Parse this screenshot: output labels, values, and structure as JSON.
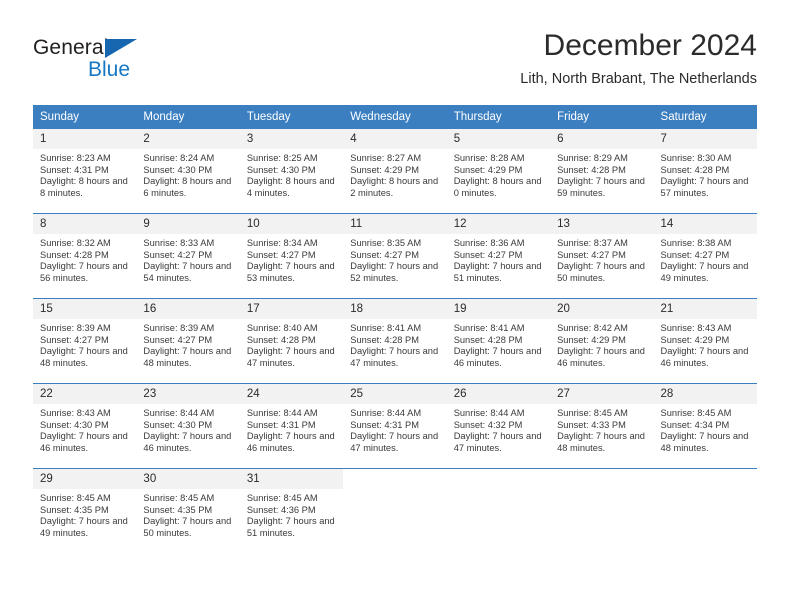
{
  "logo": {
    "word_top": "General",
    "word_bottom": "Blue",
    "accent_color": "#1877c4",
    "text_color": "#231f20"
  },
  "header": {
    "title": "December 2024",
    "subtitle": "Lith, North Brabant, The Netherlands"
  },
  "theme": {
    "header_row_bg": "#3c7fc1",
    "header_row_text": "#ffffff",
    "daynum_bg": "#f2f2f2",
    "body_text": "#3a3a3a"
  },
  "calendar": {
    "weekday_headers": [
      "Sunday",
      "Monday",
      "Tuesday",
      "Wednesday",
      "Thursday",
      "Friday",
      "Saturday"
    ],
    "weeks": [
      [
        {
          "day": "1",
          "sunrise": "Sunrise: 8:23 AM",
          "sunset": "Sunset: 4:31 PM",
          "daylight": "Daylight: 8 hours and 8 minutes."
        },
        {
          "day": "2",
          "sunrise": "Sunrise: 8:24 AM",
          "sunset": "Sunset: 4:30 PM",
          "daylight": "Daylight: 8 hours and 6 minutes."
        },
        {
          "day": "3",
          "sunrise": "Sunrise: 8:25 AM",
          "sunset": "Sunset: 4:30 PM",
          "daylight": "Daylight: 8 hours and 4 minutes."
        },
        {
          "day": "4",
          "sunrise": "Sunrise: 8:27 AM",
          "sunset": "Sunset: 4:29 PM",
          "daylight": "Daylight: 8 hours and 2 minutes."
        },
        {
          "day": "5",
          "sunrise": "Sunrise: 8:28 AM",
          "sunset": "Sunset: 4:29 PM",
          "daylight": "Daylight: 8 hours and 0 minutes."
        },
        {
          "day": "6",
          "sunrise": "Sunrise: 8:29 AM",
          "sunset": "Sunset: 4:28 PM",
          "daylight": "Daylight: 7 hours and 59 minutes."
        },
        {
          "day": "7",
          "sunrise": "Sunrise: 8:30 AM",
          "sunset": "Sunset: 4:28 PM",
          "daylight": "Daylight: 7 hours and 57 minutes."
        }
      ],
      [
        {
          "day": "8",
          "sunrise": "Sunrise: 8:32 AM",
          "sunset": "Sunset: 4:28 PM",
          "daylight": "Daylight: 7 hours and 56 minutes."
        },
        {
          "day": "9",
          "sunrise": "Sunrise: 8:33 AM",
          "sunset": "Sunset: 4:27 PM",
          "daylight": "Daylight: 7 hours and 54 minutes."
        },
        {
          "day": "10",
          "sunrise": "Sunrise: 8:34 AM",
          "sunset": "Sunset: 4:27 PM",
          "daylight": "Daylight: 7 hours and 53 minutes."
        },
        {
          "day": "11",
          "sunrise": "Sunrise: 8:35 AM",
          "sunset": "Sunset: 4:27 PM",
          "daylight": "Daylight: 7 hours and 52 minutes."
        },
        {
          "day": "12",
          "sunrise": "Sunrise: 8:36 AM",
          "sunset": "Sunset: 4:27 PM",
          "daylight": "Daylight: 7 hours and 51 minutes."
        },
        {
          "day": "13",
          "sunrise": "Sunrise: 8:37 AM",
          "sunset": "Sunset: 4:27 PM",
          "daylight": "Daylight: 7 hours and 50 minutes."
        },
        {
          "day": "14",
          "sunrise": "Sunrise: 8:38 AM",
          "sunset": "Sunset: 4:27 PM",
          "daylight": "Daylight: 7 hours and 49 minutes."
        }
      ],
      [
        {
          "day": "15",
          "sunrise": "Sunrise: 8:39 AM",
          "sunset": "Sunset: 4:27 PM",
          "daylight": "Daylight: 7 hours and 48 minutes."
        },
        {
          "day": "16",
          "sunrise": "Sunrise: 8:39 AM",
          "sunset": "Sunset: 4:27 PM",
          "daylight": "Daylight: 7 hours and 48 minutes."
        },
        {
          "day": "17",
          "sunrise": "Sunrise: 8:40 AM",
          "sunset": "Sunset: 4:28 PM",
          "daylight": "Daylight: 7 hours and 47 minutes."
        },
        {
          "day": "18",
          "sunrise": "Sunrise: 8:41 AM",
          "sunset": "Sunset: 4:28 PM",
          "daylight": "Daylight: 7 hours and 47 minutes."
        },
        {
          "day": "19",
          "sunrise": "Sunrise: 8:41 AM",
          "sunset": "Sunset: 4:28 PM",
          "daylight": "Daylight: 7 hours and 46 minutes."
        },
        {
          "day": "20",
          "sunrise": "Sunrise: 8:42 AM",
          "sunset": "Sunset: 4:29 PM",
          "daylight": "Daylight: 7 hours and 46 minutes."
        },
        {
          "day": "21",
          "sunrise": "Sunrise: 8:43 AM",
          "sunset": "Sunset: 4:29 PM",
          "daylight": "Daylight: 7 hours and 46 minutes."
        }
      ],
      [
        {
          "day": "22",
          "sunrise": "Sunrise: 8:43 AM",
          "sunset": "Sunset: 4:30 PM",
          "daylight": "Daylight: 7 hours and 46 minutes."
        },
        {
          "day": "23",
          "sunrise": "Sunrise: 8:44 AM",
          "sunset": "Sunset: 4:30 PM",
          "daylight": "Daylight: 7 hours and 46 minutes."
        },
        {
          "day": "24",
          "sunrise": "Sunrise: 8:44 AM",
          "sunset": "Sunset: 4:31 PM",
          "daylight": "Daylight: 7 hours and 46 minutes."
        },
        {
          "day": "25",
          "sunrise": "Sunrise: 8:44 AM",
          "sunset": "Sunset: 4:31 PM",
          "daylight": "Daylight: 7 hours and 47 minutes."
        },
        {
          "day": "26",
          "sunrise": "Sunrise: 8:44 AM",
          "sunset": "Sunset: 4:32 PM",
          "daylight": "Daylight: 7 hours and 47 minutes."
        },
        {
          "day": "27",
          "sunrise": "Sunrise: 8:45 AM",
          "sunset": "Sunset: 4:33 PM",
          "daylight": "Daylight: 7 hours and 48 minutes."
        },
        {
          "day": "28",
          "sunrise": "Sunrise: 8:45 AM",
          "sunset": "Sunset: 4:34 PM",
          "daylight": "Daylight: 7 hours and 48 minutes."
        }
      ],
      [
        {
          "day": "29",
          "sunrise": "Sunrise: 8:45 AM",
          "sunset": "Sunset: 4:35 PM",
          "daylight": "Daylight: 7 hours and 49 minutes."
        },
        {
          "day": "30",
          "sunrise": "Sunrise: 8:45 AM",
          "sunset": "Sunset: 4:35 PM",
          "daylight": "Daylight: 7 hours and 50 minutes."
        },
        {
          "day": "31",
          "sunrise": "Sunrise: 8:45 AM",
          "sunset": "Sunset: 4:36 PM",
          "daylight": "Daylight: 7 hours and 51 minutes."
        },
        {
          "day": "",
          "sunrise": "",
          "sunset": "",
          "daylight": ""
        },
        {
          "day": "",
          "sunrise": "",
          "sunset": "",
          "daylight": ""
        },
        {
          "day": "",
          "sunrise": "",
          "sunset": "",
          "daylight": ""
        },
        {
          "day": "",
          "sunrise": "",
          "sunset": "",
          "daylight": ""
        }
      ]
    ]
  }
}
